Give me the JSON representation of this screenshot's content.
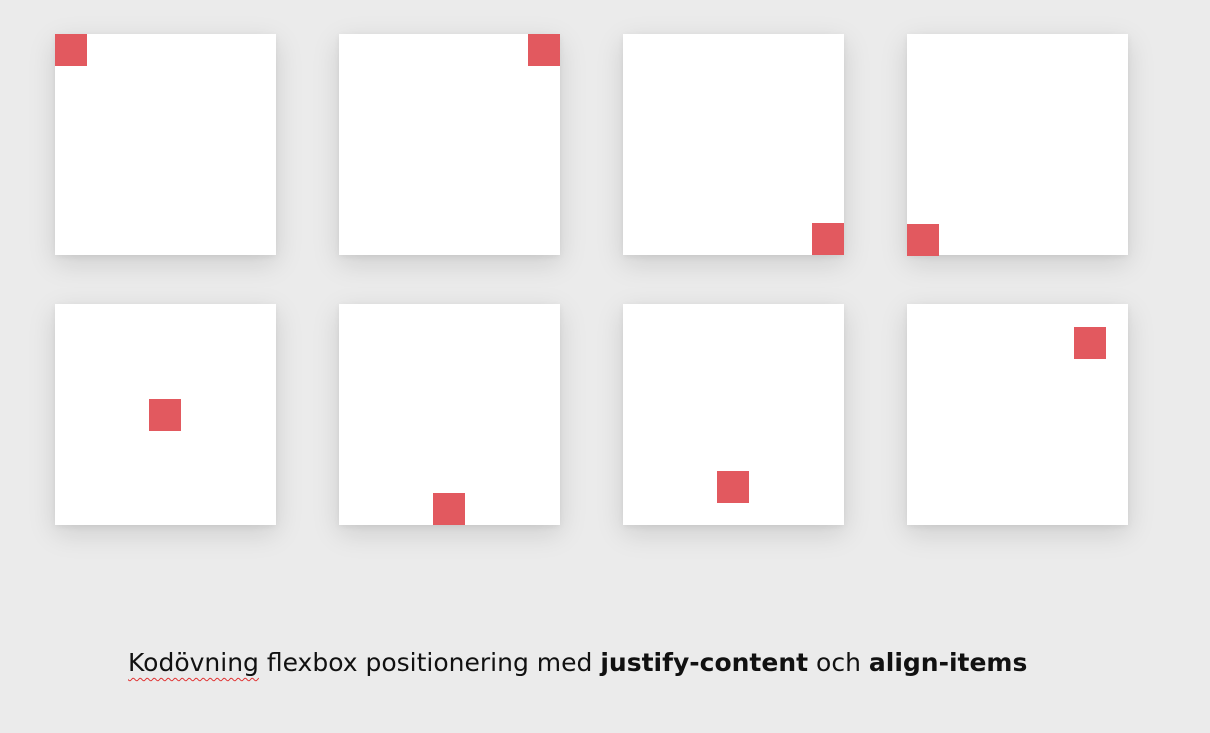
{
  "colors": {
    "background": "#ebebeb",
    "box": "#ffffff",
    "square": "#e2595f",
    "text": "#111111",
    "spellcheck_underline": "#e03030"
  },
  "examples": [
    {
      "row": 1,
      "col": 1,
      "square_position": "top-left"
    },
    {
      "row": 1,
      "col": 2,
      "square_position": "top-right"
    },
    {
      "row": 1,
      "col": 3,
      "square_position": "bottom-right"
    },
    {
      "row": 1,
      "col": 4,
      "square_position": "bottom-left"
    },
    {
      "row": 2,
      "col": 1,
      "square_position": "center"
    },
    {
      "row": 2,
      "col": 2,
      "square_position": "bottom-center"
    },
    {
      "row": 2,
      "col": 3,
      "square_position": "near-bottom-center"
    },
    {
      "row": 2,
      "col": 4,
      "square_position": "near-top-right"
    }
  ],
  "caption": {
    "word1": "Kodövning",
    "text1": " flexbox positionering med ",
    "bold1": "justify-content",
    "text2": " och ",
    "bold2": "align-items"
  }
}
